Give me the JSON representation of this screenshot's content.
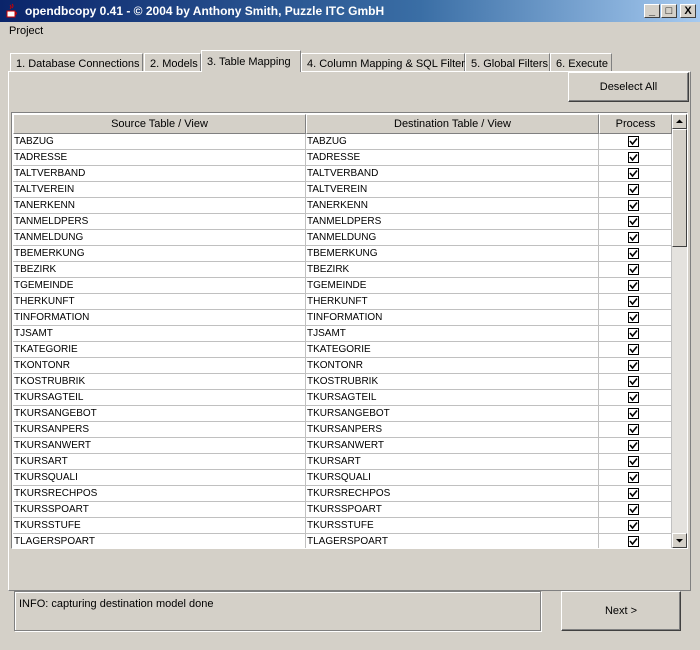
{
  "window": {
    "title": "opendbcopy 0.41 - © 2004 by Anthony Smith, Puzzle ITC GmbH",
    "minimize": "_",
    "maximize": "□",
    "close": "X"
  },
  "menu": {
    "project": "Project"
  },
  "tabs": [
    {
      "label": "1. Database Connections"
    },
    {
      "label": "2. Models"
    },
    {
      "label": "3. Table Mapping",
      "active": true
    },
    {
      "label": "4. Column Mapping & SQL Filters"
    },
    {
      "label": "5. Global Filters"
    },
    {
      "label": "6. Execute"
    }
  ],
  "toolbar": {
    "deselect_all": "Deselect All"
  },
  "table": {
    "columns": [
      "Source Table / View",
      "Destination Table / View",
      "Process"
    ],
    "rows": [
      {
        "source": "TABZUG",
        "destination": "TABZUG",
        "process": true
      },
      {
        "source": "TADRESSE",
        "destination": "TADRESSE",
        "process": true
      },
      {
        "source": "TALTVERBAND",
        "destination": "TALTVERBAND",
        "process": true
      },
      {
        "source": "TALTVEREIN",
        "destination": "TALTVEREIN",
        "process": true
      },
      {
        "source": "TANERKENN",
        "destination": "TANERKENN",
        "process": true
      },
      {
        "source": "TANMELDPERS",
        "destination": "TANMELDPERS",
        "process": true
      },
      {
        "source": "TANMELDUNG",
        "destination": "TANMELDUNG",
        "process": true
      },
      {
        "source": "TBEMERKUNG",
        "destination": "TBEMERKUNG",
        "process": true
      },
      {
        "source": "TBEZIRK",
        "destination": "TBEZIRK",
        "process": true
      },
      {
        "source": "TGEMEINDE",
        "destination": "TGEMEINDE",
        "process": true
      },
      {
        "source": "THERKUNFT",
        "destination": "THERKUNFT",
        "process": true
      },
      {
        "source": "TINFORMATION",
        "destination": "TINFORMATION",
        "process": true
      },
      {
        "source": "TJSAMT",
        "destination": "TJSAMT",
        "process": true
      },
      {
        "source": "TKATEGORIE",
        "destination": "TKATEGORIE",
        "process": true
      },
      {
        "source": "TKONTONR",
        "destination": "TKONTONR",
        "process": true
      },
      {
        "source": "TKOSTRUBRIK",
        "destination": "TKOSTRUBRIK",
        "process": true
      },
      {
        "source": "TKURSAGTEIL",
        "destination": "TKURSAGTEIL",
        "process": true
      },
      {
        "source": "TKURSANGEBOT",
        "destination": "TKURSANGEBOT",
        "process": true
      },
      {
        "source": "TKURSANPERS",
        "destination": "TKURSANPERS",
        "process": true
      },
      {
        "source": "TKURSANWERT",
        "destination": "TKURSANWERT",
        "process": true
      },
      {
        "source": "TKURSART",
        "destination": "TKURSART",
        "process": true
      },
      {
        "source": "TKURSQUALI",
        "destination": "TKURSQUALI",
        "process": true
      },
      {
        "source": "TKURSRECHPOS",
        "destination": "TKURSRECHPOS",
        "process": true
      },
      {
        "source": "TKURSSPOART",
        "destination": "TKURSSPOART",
        "process": true
      },
      {
        "source": "TKURSSTUFE",
        "destination": "TKURSSTUFE",
        "process": true
      },
      {
        "source": "TLAGERSPOART",
        "destination": "TLAGERSPOART",
        "process": true
      }
    ]
  },
  "status": {
    "message": "INFO: capturing destination model done"
  },
  "footer": {
    "next": "Next >"
  },
  "colors": {
    "title_start": "#0a246a",
    "title_end": "#a6caf0",
    "face": "#d4d0c8"
  }
}
